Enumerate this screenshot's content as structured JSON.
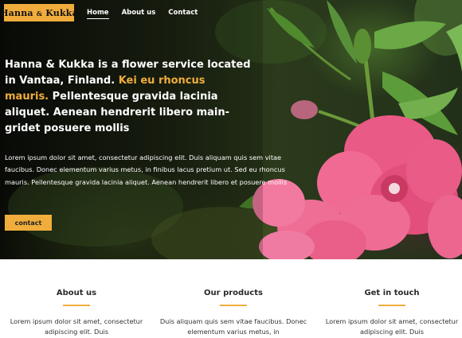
{
  "logo": {
    "name": "Hanna",
    "amp": "&",
    "name2": "Kukka"
  },
  "nav": [
    {
      "label": "Home"
    },
    {
      "label": "About us"
    },
    {
      "label": "Contact"
    }
  ],
  "hero": {
    "headline_part1": "Hanna & Kukka is a flower service located in Vantaa, Finland.",
    "headline_accent": "Kei eu rhoncus mauris.",
    "headline_part2": "Pellentesque gravida lacinia aliquet. Aenean hendrerit libero main-gridet posuere mollis",
    "lead": "Lorem ipsum dolor sit amet, consectetur adipiscing elit. Duis aliquam quis sem vitae faucibus. Donec elementum varius metus, in finibus lacus pretium ut. Sed eu rhoncus mauris. Pellentesque gravida lacinia aliquet. Aenean hendrerit libero et posuere mollis",
    "cta_label": "contact"
  },
  "features": [
    {
      "title": "About us",
      "text": "Lorem ipsum dolor sit amet, consectetur adipiscing elit. Duis"
    },
    {
      "title": "Our products",
      "text": "Duis aliquam quis sem vitae faucibus. Donec elementum varius metus, in"
    },
    {
      "title": "Get in touch",
      "text": "Lorem ipsum dolor sit amet, consectetur adipiscing elit. Duis"
    }
  ],
  "colors": {
    "accent": "#f0ad3c",
    "flower_pink": "#e8507e",
    "leaf_green": "#4f8a2e"
  }
}
